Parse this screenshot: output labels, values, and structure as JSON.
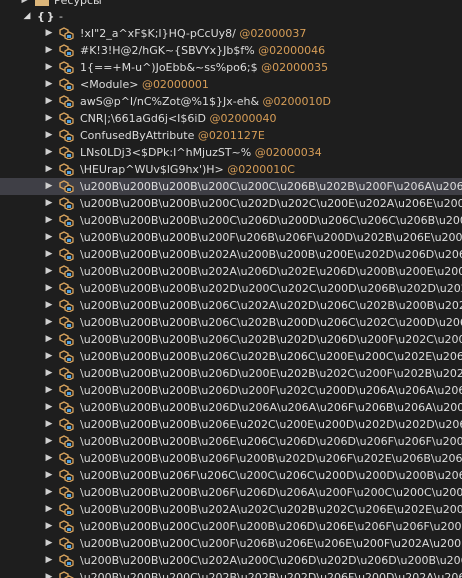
{
  "tree": {
    "resources_label": "Ресурсы",
    "namespace_label": "-",
    "types": [
      {
        "name": "!xI\"2_a^xF$K;I}HQ-pCcUy8/",
        "token": "@02000037"
      },
      {
        "name": "#K!3!H@2/hGK~{SBVYx}Jb$f%",
        "token": "@02000046"
      },
      {
        "name": "1{==+M-u^)JoEbb&~ss%po6;$",
        "token": "@02000035"
      },
      {
        "name": "<Module>",
        "token": "@02000001"
      },
      {
        "name": "awS@p^I/nC%Zot@%1$}Jx-eh&",
        "token": "@0200010D"
      },
      {
        "name": "CNR|;\\661aGd6j<I$6iD",
        "token": "@02000040"
      },
      {
        "name": "ConfusedByAttribute",
        "token": "@0201127E"
      },
      {
        "name": "LNs0LDj3<$DPk:I^hMjuzST~%",
        "token": "@02000034"
      },
      {
        "name": "\\HEUrap^WUv$lG9hx')H>",
        "token": "@0200010C"
      },
      {
        "name": "\\u200B\\u200B\\u200B\\u200C\\u200C\\u206B\\u202B\\u200F\\u206A\\u206D\\u",
        "token": ""
      },
      {
        "name": "\\u200B\\u200B\\u200B\\u200C\\u202D\\u202C\\u200E\\u202A\\u206E\\u200B\\u",
        "token": ""
      },
      {
        "name": "\\u200B\\u200B\\u200B\\u200C\\u206D\\u200D\\u206C\\u206C\\u206B\\u200B\\u",
        "token": ""
      },
      {
        "name": "\\u200B\\u200B\\u200B\\u200F\\u206B\\u206F\\u200D\\u202B\\u206E\\u200E\\u",
        "token": ""
      },
      {
        "name": "\\u200B\\u200B\\u200B\\u202A\\u200B\\u200B\\u200E\\u202D\\u206D\\u206C\\u",
        "token": ""
      },
      {
        "name": "\\u200B\\u200B\\u200B\\u202A\\u206D\\u202E\\u206D\\u200B\\u200E\\u200E\\u",
        "token": ""
      },
      {
        "name": "\\u200B\\u200B\\u200B\\u202D\\u200C\\u202C\\u200D\\u206B\\u202D\\u202A\\u",
        "token": ""
      },
      {
        "name": "\\u200B\\u200B\\u200B\\u206C\\u202A\\u202D\\u206C\\u202B\\u200B\\u202A\\u",
        "token": ""
      },
      {
        "name": "\\u200B\\u200B\\u200B\\u206C\\u202B\\u200D\\u206C\\u202C\\u200D\\u206A\\u",
        "token": ""
      },
      {
        "name": "\\u200B\\u200B\\u200B\\u206C\\u202B\\u202D\\u206D\\u200F\\u202C\\u200E\\u",
        "token": ""
      },
      {
        "name": "\\u200B\\u200B\\u200B\\u206C\\u202B\\u206C\\u200E\\u200C\\u202E\\u206B\\u",
        "token": ""
      },
      {
        "name": "\\u200B\\u200B\\u200B\\u206D\\u200E\\u202B\\u202C\\u200F\\u202B\\u202E\\u",
        "token": ""
      },
      {
        "name": "\\u200B\\u200B\\u200B\\u206D\\u200F\\u202C\\u200D\\u206A\\u206A\\u206D\\u",
        "token": ""
      },
      {
        "name": "\\u200B\\u200B\\u200B\\u206D\\u206A\\u206A\\u206F\\u206B\\u206A\\u200D\\u",
        "token": ""
      },
      {
        "name": "\\u200B\\u200B\\u200B\\u206E\\u202C\\u200E\\u200D\\u202D\\u202D\\u206A\\u",
        "token": ""
      },
      {
        "name": "\\u200B\\u200B\\u200B\\u206E\\u206C\\u206D\\u206D\\u206F\\u206F\\u200F\\u",
        "token": ""
      },
      {
        "name": "\\u200B\\u200B\\u200B\\u206F\\u200B\\u202D\\u206F\\u202E\\u206B\\u206B\\u",
        "token": ""
      },
      {
        "name": "\\u200B\\u200B\\u206F\\u206C\\u200C\\u206C\\u200D\\u200D\\u200B\\u206C\\u",
        "token": ""
      },
      {
        "name": "\\u200B\\u200B\\u200B\\u206F\\u206D\\u206A\\u200F\\u200C\\u200C\\u200F\\u",
        "token": ""
      },
      {
        "name": "\\u200B\\u200B\\u200B\\u202A\\u202C\\u202B\\u202C\\u206E\\u202E\\u200C\\u",
        "token": ""
      },
      {
        "name": "\\u200B\\u200B\\u200C\\u200F\\u200B\\u206D\\u206E\\u206F\\u206F\\u200E\\u",
        "token": ""
      },
      {
        "name": "\\u200B\\u200B\\u200C\\u200F\\u206B\\u206E\\u206E\\u200F\\u202A\\u200E\\u",
        "token": ""
      },
      {
        "name": "\\u200B\\u200B\\u200C\\u202A\\u200C\\u206D\\u202D\\u206D\\u200B\\u206C\\u",
        "token": ""
      },
      {
        "name": "\\u200B\\u200B\\u200C\\u202B\\u202B\\u202D\\u206F\\u200D\\u202A\\u206D\\u",
        "token": ""
      }
    ]
  },
  "colors": {
    "background": "#1e1e1e",
    "selected_row": "#3f3f46",
    "token": "#d69d57",
    "text": "#dcdcdc",
    "class_icon_orange": "#d7a25c",
    "class_icon_blue": "#4da0e0"
  },
  "icons": {
    "expand_arrow": "triangle-right-icon",
    "namespace": "namespace-braces-icon",
    "type": "class-icon",
    "folder": "folder-icon"
  }
}
